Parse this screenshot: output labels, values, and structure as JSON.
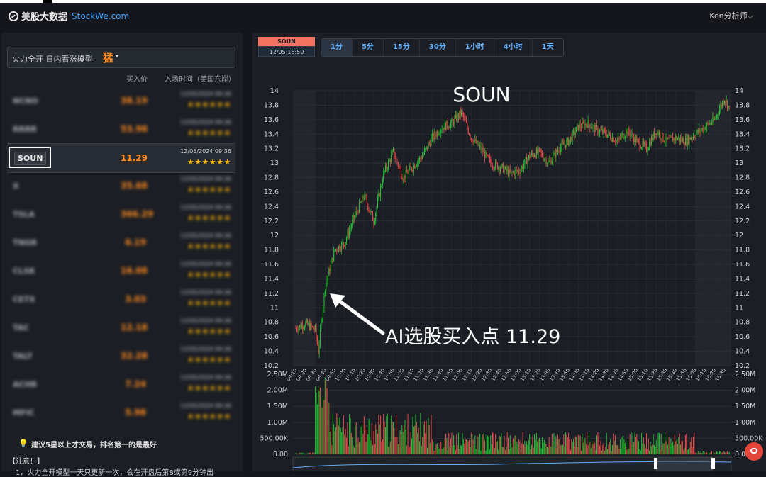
{
  "brand": {
    "cn": "美股大数据",
    "en": "StockWe.com"
  },
  "user": {
    "label": "Ken分析师⌵"
  },
  "model": {
    "label": "火力全开 日内看涨模型",
    "tag": "猛"
  },
  "columns": {
    "price": "买入价",
    "time": "入场时间（美国东岸）"
  },
  "rows": [
    {
      "symbol": "NCNO",
      "price": "38.19",
      "time": "12/05/2024 09:36",
      "stars": "★★★★★★",
      "blurred": true
    },
    {
      "symbol": "RRRR",
      "price": "53.98",
      "time": "12/05/2024 09:36",
      "stars": "★★★★★★",
      "blurred": true
    },
    {
      "symbol": "SOUN",
      "price": "11.29",
      "time": "12/05/2024 09:36",
      "stars": "★★★★★★",
      "blurred": false
    },
    {
      "symbol": "X",
      "price": "35.68",
      "time": "12/05/2024 09:36",
      "stars": "★★★★★★",
      "blurred": true
    },
    {
      "symbol": "TSLA",
      "price": "366.29",
      "time": "12/05/2024 09:36",
      "stars": "★★★★★★",
      "blurred": true
    },
    {
      "symbol": "TNGR",
      "price": "6.19",
      "time": "12/05/2024 09:36",
      "stars": "★★★★★★",
      "blurred": true
    },
    {
      "symbol": "CLSK",
      "price": "16.08",
      "time": "12/05/2024 09:36",
      "stars": "★★★★★★",
      "blurred": true
    },
    {
      "symbol": "CETX",
      "price": "3.03",
      "time": "12/05/2024 09:36",
      "stars": "★★★★★★",
      "blurred": true
    },
    {
      "symbol": "TAC",
      "price": "12.18",
      "time": "12/05/2024 09:36",
      "stars": "★★★★★★",
      "blurred": true
    },
    {
      "symbol": "TALT",
      "price": "32.28",
      "time": "12/05/2024 09:36",
      "stars": "★★★★★★",
      "blurred": true
    },
    {
      "symbol": "ACHR",
      "price": "7.24",
      "time": "12/05/2024 09:36",
      "stars": "★★★★★★",
      "blurred": true
    },
    {
      "symbol": "MFIC",
      "price": "5.98",
      "time": "12/05/2024 09:36",
      "stars": "★★★★★★",
      "blurred": true
    }
  ],
  "tip": "建议5星以上才交易，排名第一的是最好",
  "note": {
    "title": "【注意！】",
    "line1": "1．火力全开模型一天只更新一次，会在开盘后第8或第9分钟出"
  },
  "chart_header": {
    "symbol": "SOUN",
    "date": "12/05 18:50"
  },
  "intervals": [
    "1分",
    "5分",
    "15分",
    "30分",
    "1小时",
    "4小时",
    "1天"
  ],
  "active_interval": "1分",
  "annotation": "AI选股买入点 11.29",
  "chart_data": [
    {
      "type": "line",
      "title": "SOUN",
      "description_kind": "candlestick",
      "xlabel": "",
      "ylabel": "",
      "ylim": [
        10.2,
        14.0
      ],
      "yticks": [
        "14",
        "13.8",
        "13.6",
        "13.4",
        "13.2",
        "13",
        "12.8",
        "12.6",
        "12.4",
        "12.2",
        "12",
        "11.8",
        "11.6",
        "11.4",
        "11.2",
        "11",
        "10.8",
        "10.6",
        "10.4",
        "10.2"
      ],
      "xticks": [
        "09:10",
        "09:20",
        "09:30",
        "09:40",
        "09:50",
        "10:00",
        "10:10",
        "10:20",
        "10:30",
        "10:40",
        "10:50",
        "11:00",
        "11:10",
        "11:20",
        "11:30",
        "11:40",
        "11:50",
        "12:00",
        "12:10",
        "12:20",
        "12:30",
        "12:40",
        "12:50",
        "13:00",
        "13:10",
        "13:20",
        "13:30",
        "13:40",
        "13:50",
        "14:00",
        "14:10",
        "14:20",
        "14:30",
        "14:40",
        "14:50",
        "15:00",
        "15:10",
        "15:20",
        "15:30",
        "15:40",
        "15:50",
        "16:00",
        "16:10",
        "16:20",
        "16:30"
      ],
      "x": [
        "09:10",
        "09:20",
        "09:30",
        "09:33",
        "09:40",
        "09:50",
        "10:00",
        "10:10",
        "10:20",
        "10:30",
        "10:40",
        "10:50",
        "11:00",
        "11:10",
        "11:20",
        "11:30",
        "11:40",
        "11:50",
        "12:00",
        "12:10",
        "12:20",
        "12:30",
        "12:40",
        "12:50",
        "13:00",
        "13:10",
        "13:20",
        "13:30",
        "13:40",
        "13:50",
        "14:00",
        "14:10",
        "14:20",
        "14:30",
        "14:40",
        "14:50",
        "15:00",
        "15:10",
        "15:20",
        "15:30",
        "15:40",
        "15:50",
        "16:00",
        "16:10",
        "16:20",
        "16:30",
        "16:35"
      ],
      "values": [
        10.72,
        10.78,
        10.7,
        10.4,
        11.29,
        11.8,
        11.9,
        12.25,
        12.55,
        12.2,
        12.85,
        13.15,
        12.8,
        12.95,
        13.1,
        13.35,
        13.5,
        13.55,
        13.7,
        13.35,
        13.2,
        13.0,
        12.95,
        12.85,
        12.9,
        13.1,
        13.15,
        13.0,
        13.2,
        13.3,
        13.5,
        13.55,
        13.45,
        13.4,
        13.3,
        13.45,
        13.3,
        13.2,
        13.45,
        13.3,
        13.35,
        13.3,
        13.4,
        13.5,
        13.6,
        13.9,
        13.75
      ],
      "shaded_sessions": [
        "pre-market 09:10–09:30",
        "after-hours 16:00–16:35"
      ]
    },
    {
      "type": "bar",
      "title": "",
      "ylim": [
        0,
        2500000
      ],
      "yticks": [
        "2.50M",
        "2.00M",
        "1.50M",
        "1.00M",
        "500.00K",
        "0.00"
      ],
      "peak_volume_at": "09:40",
      "peak_volume": 2400000,
      "typical_volume": 400000,
      "colors": {
        "up": "#25c635",
        "down": "#ef4b4b"
      }
    }
  ],
  "colors": {
    "up": "#25c635",
    "down": "#ef4b4b",
    "accent": "#ff8a1c",
    "link": "#5fb0ff",
    "bg": "#14161c",
    "panel": "#1b1e25"
  }
}
